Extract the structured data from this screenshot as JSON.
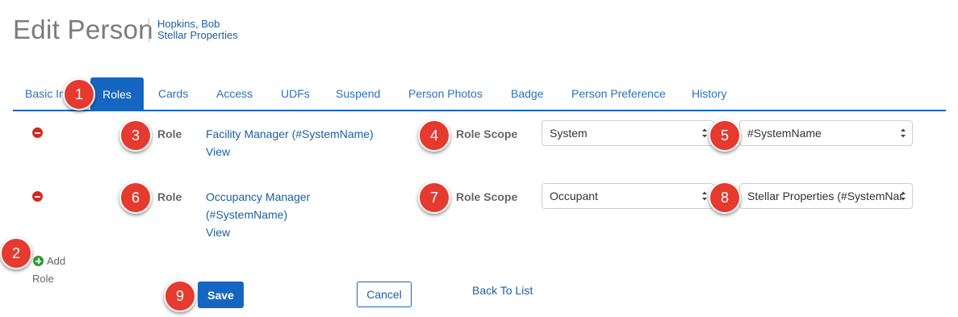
{
  "header": {
    "title": "Edit Person",
    "person_name": "Hopkins, Bob",
    "company": "Stellar Properties"
  },
  "tabs": [
    {
      "label": "Basic In"
    },
    {
      "label": "Roles",
      "active": true
    },
    {
      "label": "Cards"
    },
    {
      "label": "Access"
    },
    {
      "label": "UDFs"
    },
    {
      "label": "Suspend"
    },
    {
      "label": "Person Photos"
    },
    {
      "label": "Badge"
    },
    {
      "label": "Person Preference"
    },
    {
      "label": "History"
    }
  ],
  "roles": [
    {
      "label": "Role",
      "role_name": "Facility Manager (#SystemName)",
      "view_label": "View",
      "scope_label": "Role Scope",
      "scope_type": "System",
      "scope_value": "#SystemName"
    },
    {
      "label": "Role",
      "role_name_line1": "Occupancy Manager",
      "role_name_line2": "(#SystemName)",
      "view_label": "View",
      "scope_label": "Role Scope",
      "scope_type": "Occupant",
      "scope_value": "Stellar Properties (#SystemNar"
    }
  ],
  "add_role": {
    "line1": "Add",
    "line2": "Role"
  },
  "actions": {
    "save": "Save",
    "cancel": "Cancel",
    "back": "Back To List"
  },
  "badges": [
    "1",
    "2",
    "3",
    "4",
    "5",
    "6",
    "7",
    "8",
    "9"
  ],
  "colors": {
    "primary": "#1566c0",
    "link": "#1a5fa5",
    "badge": "#e53a2f",
    "remove": "#d9261c",
    "add": "#2d9c2d"
  }
}
